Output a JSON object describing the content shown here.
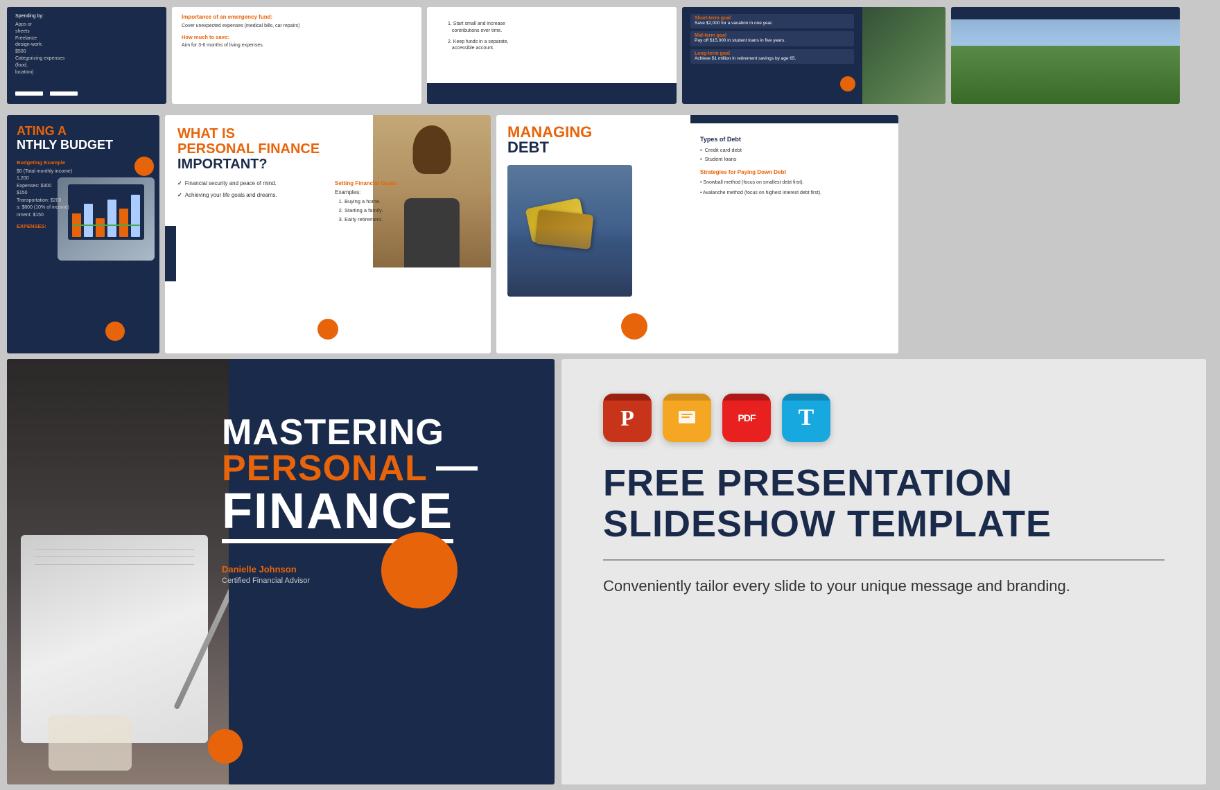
{
  "page": {
    "title": "Mastering Personal Finance - Free Presentation Template"
  },
  "slides": {
    "top_row": [
      {
        "id": "top-1",
        "type": "spending",
        "title": "Spending by:",
        "items": [
          "Apps or sheets",
          "Freelance design-work: $500",
          "Categorizing expenses (food, location)"
        ]
      },
      {
        "id": "top-2",
        "type": "emergency-fund",
        "heading": "Importance of an emergency fund:",
        "body": "Cover unexpected expenses (medical bills, car repairs)",
        "subheading": "How much to save:",
        "sub_body": "Aim for 3-6 months of living expenses."
      },
      {
        "id": "top-3",
        "type": "tips",
        "items": [
          "Start small and increase contributions over time.",
          "Keep funds in a separate, accessible account."
        ]
      },
      {
        "id": "top-4",
        "type": "goals",
        "items": [
          {
            "label": "Short-term goal",
            "desc": "Save $2,000 for a vacation in one year."
          },
          {
            "label": "Mid-term goal",
            "desc": "Pay off $15,000 in student loans in five years."
          },
          {
            "label": "Long-term goal",
            "desc": "Achieve $1 million in retirement savings by age 65."
          }
        ]
      },
      {
        "id": "top-5",
        "type": "placeholder"
      }
    ],
    "middle_row": [
      {
        "id": "mid-1",
        "type": "budget",
        "title_orange": "ATING A",
        "title_white": "NTHLY BUDGET",
        "example_label": "Budgeting Example",
        "income": "$0 (Total monthly income)",
        "expenses": [
          "1,200",
          "Expenses: $300",
          "$150",
          "Transportation: $200",
          "s: $800 (10% of income)",
          "nment: $150"
        ],
        "expenses_label": "EXPENSES:"
      },
      {
        "id": "mid-2",
        "type": "what-is-pf",
        "title_line1": "WHAT IS",
        "title_line2": "PERSONAL FINANCE",
        "title_line3": "IMPORTANT?",
        "points": [
          "Financial security and peace of mind.",
          "Achieving your life goals and dreams."
        ],
        "goals_label": "Setting Financial Goals:",
        "goals_examples_label": "Examples:",
        "goals_list": [
          "Buying a home.",
          "Starting a family.",
          "Early retirement."
        ]
      },
      {
        "id": "mid-3",
        "type": "managing-debt",
        "title_orange": "MANAGING",
        "title_white": "DEBT",
        "types_title": "Types of Debt",
        "types": [
          "Credit card debt",
          "Student loans"
        ],
        "strategies_title": "Strategies for Paying Down Debt",
        "strategies": [
          "Snowball method (focus on smallest debt first).",
          "Avalanche method (focus on highest interest debt first)."
        ]
      }
    ],
    "main_slide": {
      "title_line1": "MASTERING",
      "title_line2": "PERSONAL",
      "title_line3": "FINANCE",
      "author_name": "Danielle Johnson",
      "author_title": "Certified Financial Advisor"
    },
    "promo": {
      "title": "FREE PRESENTATION SLIDESHOW TEMPLATE",
      "tagline": "Conveniently tailor every slide to your unique message and branding.",
      "app_icons": [
        {
          "name": "PowerPoint",
          "abbr": "P",
          "type": "ppt"
        },
        {
          "name": "Google Slides",
          "abbr": "G",
          "type": "slides"
        },
        {
          "name": "PDF",
          "abbr": "PDF",
          "type": "pdf"
        },
        {
          "name": "Keynote",
          "abbr": "T",
          "type": "keynote"
        }
      ]
    }
  }
}
